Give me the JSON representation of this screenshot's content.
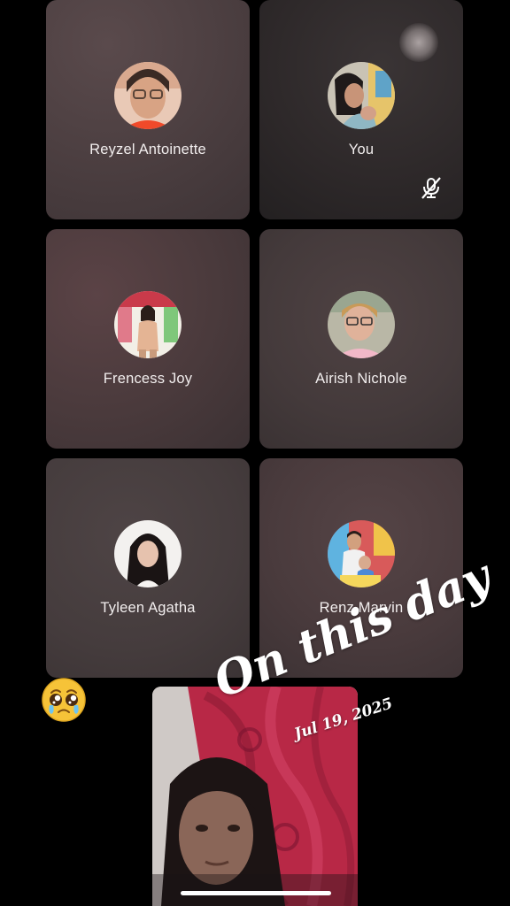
{
  "participants": [
    {
      "name": "Reyzel Antoinette",
      "muted": false
    },
    {
      "name": "You",
      "muted": true
    },
    {
      "name": "Frencess Joy",
      "muted": false
    },
    {
      "name": "Airish Nichole",
      "muted": false
    },
    {
      "name": "Tyleen Agatha",
      "muted": false
    },
    {
      "name": "Renz Marvin",
      "muted": false
    }
  ],
  "icons": {
    "mute": "microphone-off-icon",
    "reaction": "pleading-face-emoji"
  },
  "memory_sticker": {
    "title": "On this day",
    "date": "Jul 19, 2025"
  },
  "colors": {
    "background": "#000000",
    "tile": "#4a3f40",
    "text": "#f2eeee"
  }
}
